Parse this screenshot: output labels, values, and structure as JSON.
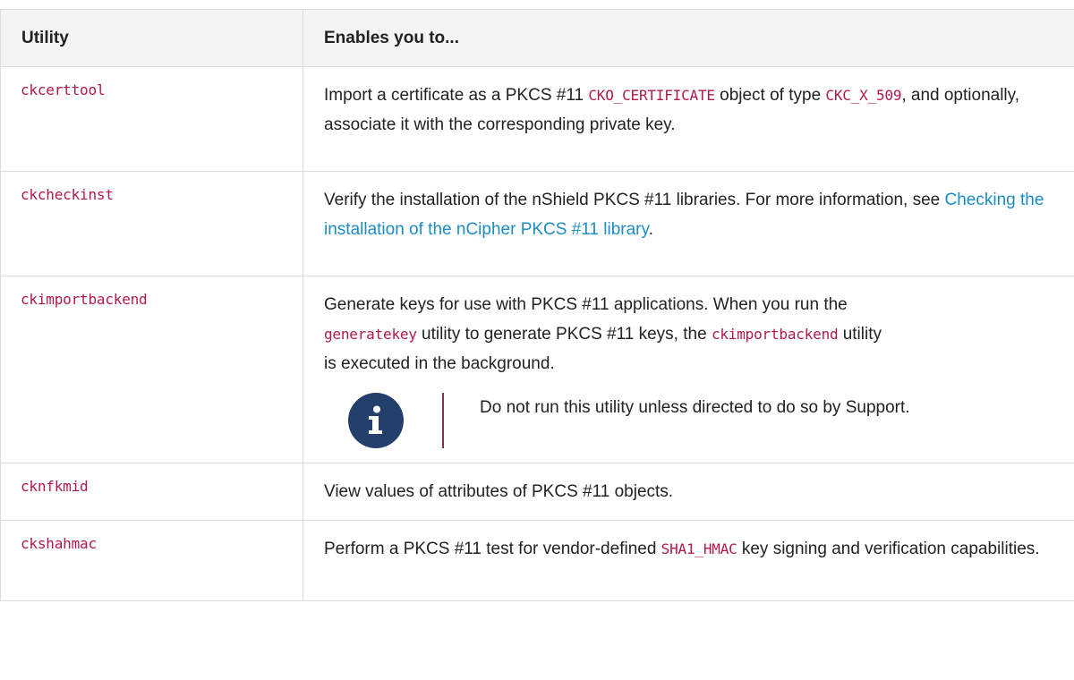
{
  "table": {
    "headers": [
      "Utility",
      "Enables you to..."
    ],
    "rows": [
      {
        "utility": "ckcerttool",
        "desc": {
          "t1": "Import a certificate as a PKCS #11 ",
          "c1": "CKO_CERTIFICATE",
          "t2": " object of type ",
          "c2": "CKC_X_509",
          "t3": ", and optionally, associate it with the corresponding private key."
        }
      },
      {
        "utility": "ckcheckinst",
        "desc": {
          "t1": "Verify the installation of the nShield PKCS #11 libraries. For more information, see ",
          "link": "Checking the installation of the nCipher PKCS #11 library",
          "t2": "."
        }
      },
      {
        "utility": "ckimportbackend",
        "desc": {
          "t1": "Generate keys for use with PKCS #11 applications. When you run the",
          "c1": "generatekey",
          "t2": " utility to generate PKCS #11 keys, the ",
          "c2": "ckimportbackend",
          "t3": " utility",
          "t4": "is executed in the background."
        },
        "note": {
          "icon": "info-icon",
          "text": "Do not run this utility unless directed to do so by Support."
        }
      },
      {
        "utility": "cknfkmid",
        "desc": {
          "t1": "View values of attributes of PKCS #11 objects."
        }
      },
      {
        "utility": "ckshahmac",
        "desc": {
          "t1": "Perform a PKCS #11 test for vendor-defined ",
          "c1": "SHA1_HMAC",
          "t2": " key signing and verification capabilities."
        }
      }
    ]
  },
  "colors": {
    "code": "#b01a4a",
    "link": "#1d8cc4",
    "note_icon_bg": "#233f6b",
    "note_bar": "#8a2d56",
    "header_bg": "#f4f4f4",
    "border": "#dddddd"
  }
}
